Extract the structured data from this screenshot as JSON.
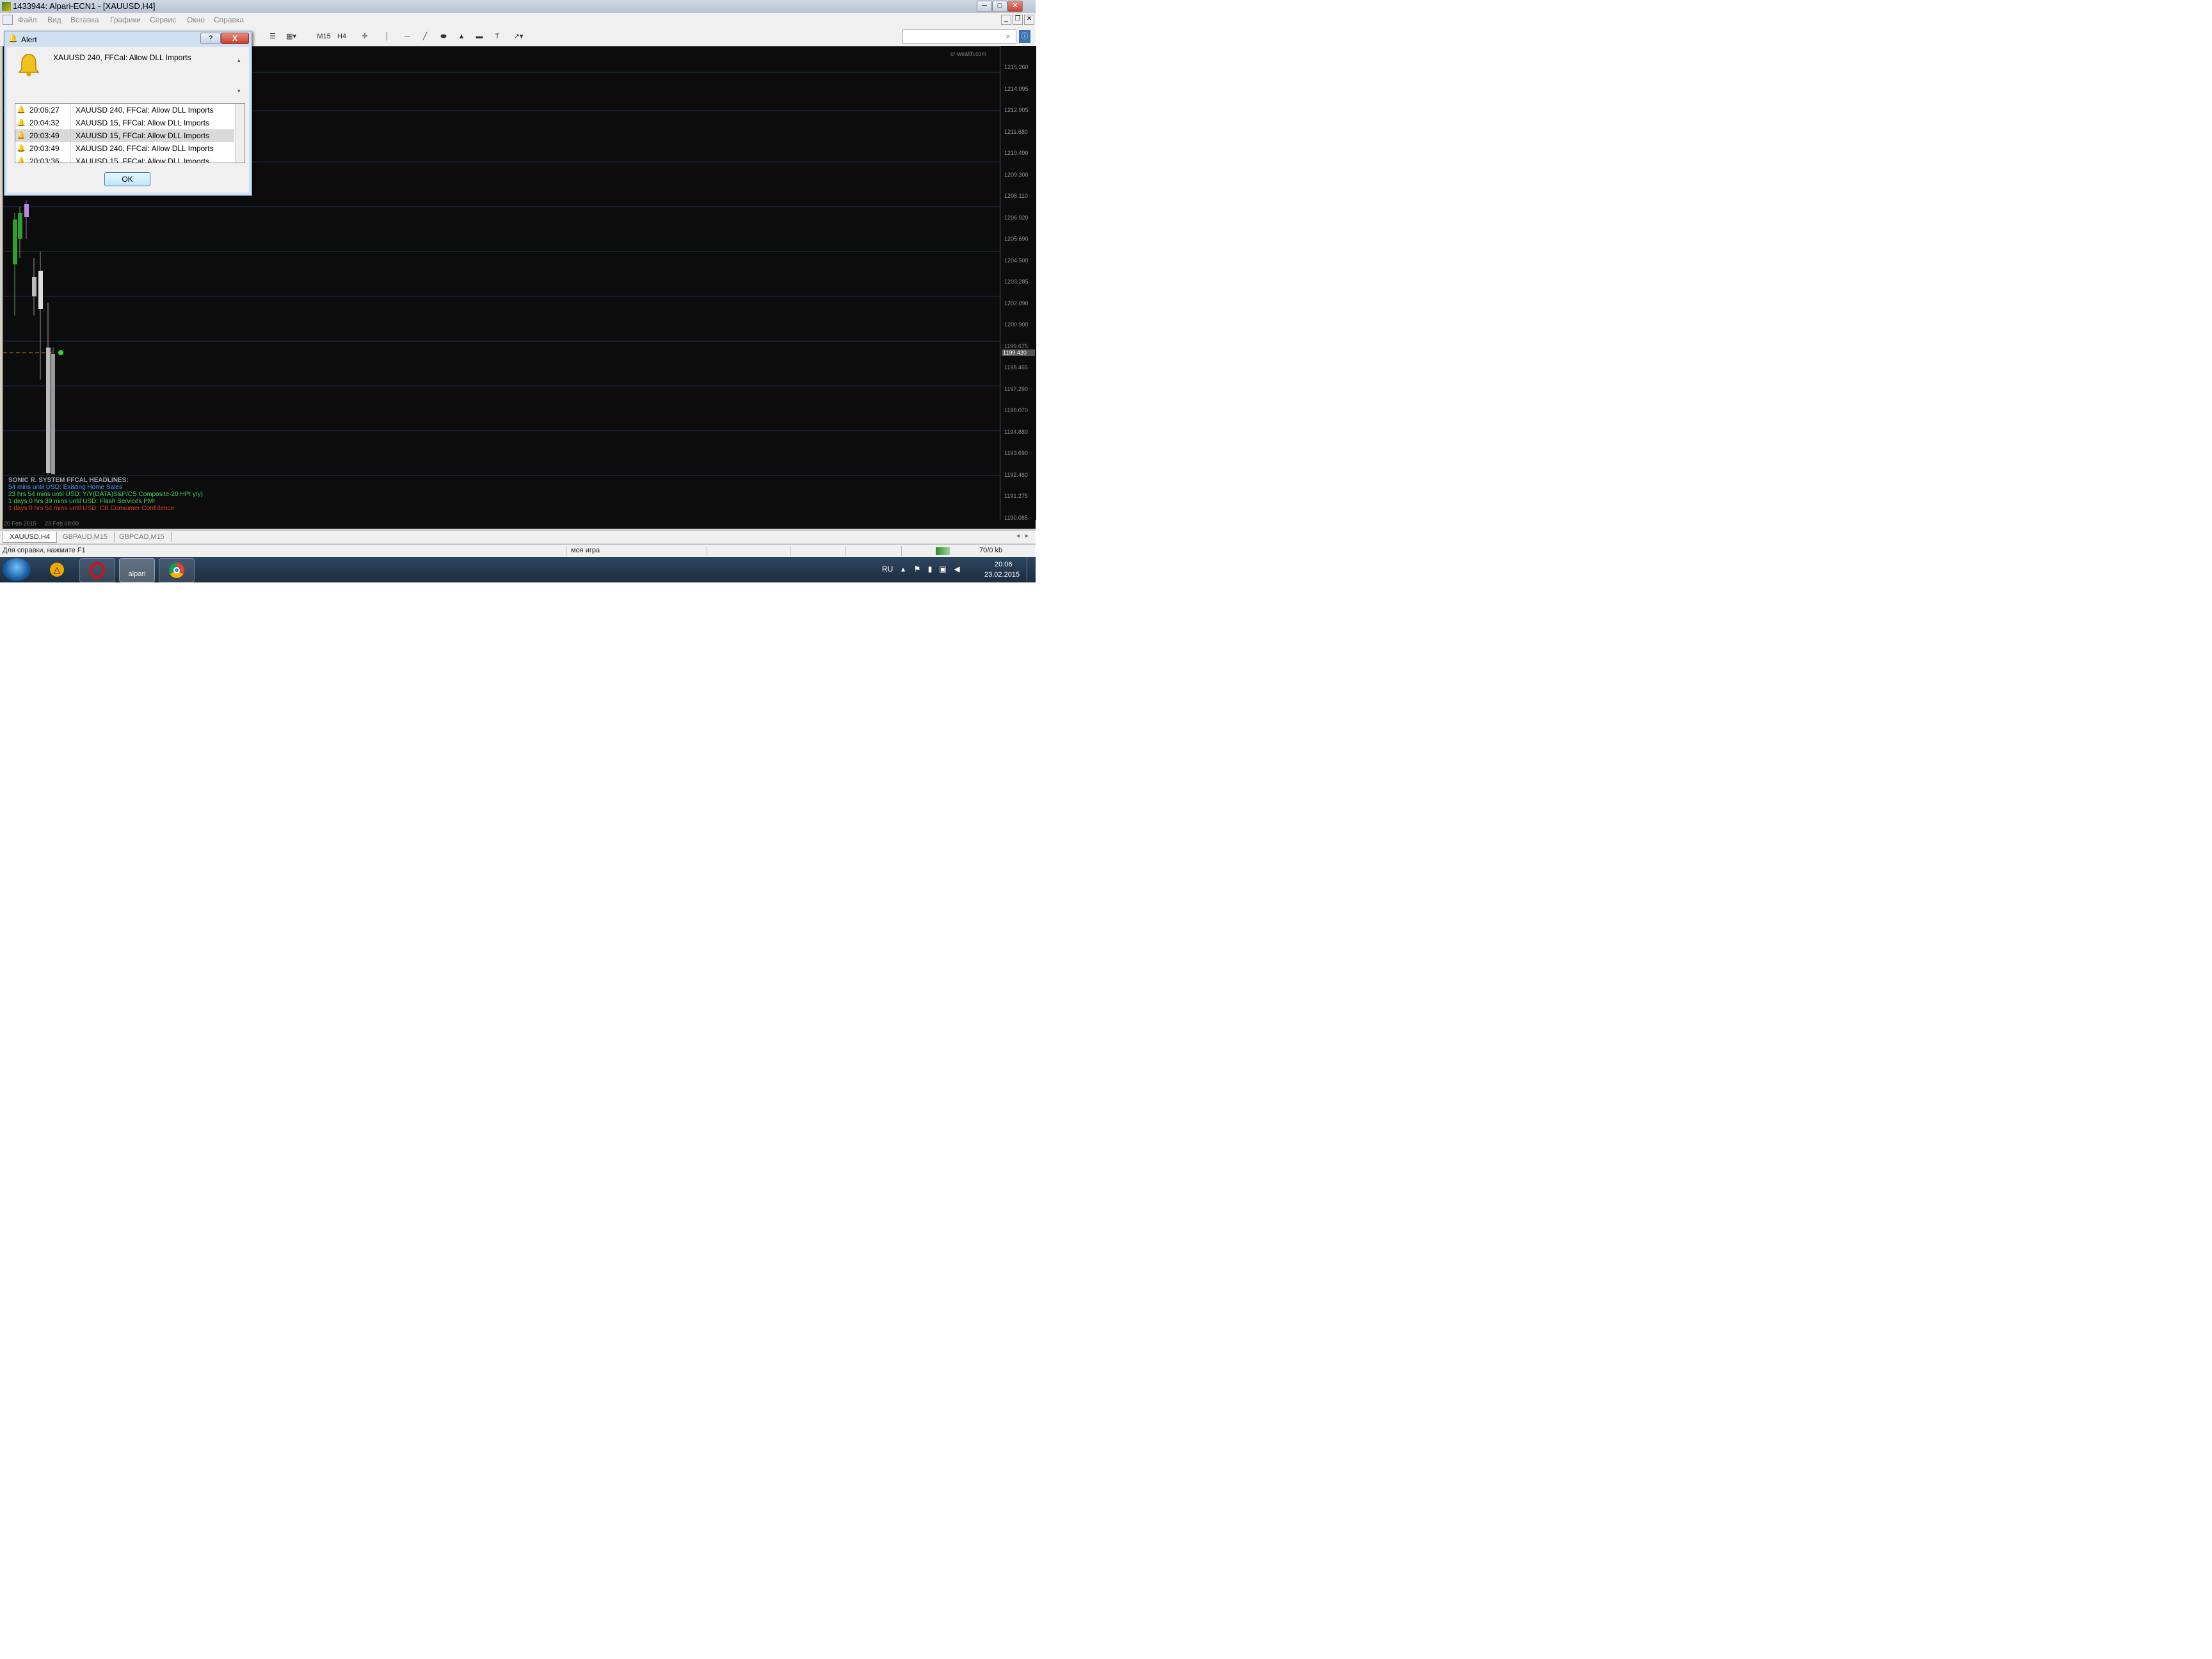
{
  "window": {
    "title": "1433944: Alpari-ECN1 - [XAUUSD,H4]",
    "minimize": "─",
    "maximize": "□",
    "close": "✕"
  },
  "menu": [
    "Файл",
    "Вид",
    "Вставка",
    "Графики",
    "Сервис",
    "Окно",
    "Справка"
  ],
  "toolbar": {
    "m15": "M15",
    "h4": "H4"
  },
  "chart": {
    "corner_label": "cr-wealth.com",
    "price_labels": [
      "1215.260",
      "1214.095",
      "1212.905",
      "1211.680",
      "1210.490",
      "1209.300",
      "1208.110",
      "1206.920",
      "1205.690",
      "1204.500",
      "1203.285",
      "1202.090",
      "1200.900",
      "1199.675",
      "1198.465",
      "1197.290",
      "1196.070",
      "1194.880",
      "1193.690",
      "1192.460",
      "1191.275",
      "1190.085"
    ],
    "current_price": "1199.420",
    "news_title": "SONIC R. SYSTEM  FFCAL HEADLINES:",
    "news_lines": [
      {
        "text": "54 mins until USD: Existing Home Sales",
        "color": "#3fa0ff"
      },
      {
        "text": "23 hrs 54 mins until USD: Y/Y(DATA)S&P/CS Composite-20 HPI y/y)",
        "color": "#3fd05f"
      },
      {
        "text": "1 days 0 hrs 39 mins until USD: Flash Services PMI",
        "color": "#3fd05f"
      },
      {
        "text": "1 days 0 hrs 54 mins until USD: CB Consumer Confidence",
        "color": "#e0392d"
      }
    ],
    "time_labels": [
      "20 Feb 2015",
      "23 Feb 08:00"
    ]
  },
  "tabs": [
    "XAUUSD,H4",
    "GBPAUD,M15",
    "GBPCAD,M15"
  ],
  "status": {
    "help": "Для справки, нажмите F1",
    "profile": "моя игра",
    "traffic": "70/0 kb"
  },
  "taskbar": {
    "alpari_label": "alpari",
    "lang": "RU",
    "time": "20:06",
    "date": "23.02.2015"
  },
  "dialog": {
    "title": "Alert",
    "help": "?",
    "close": "X",
    "message": "XAUUSD 240, FFCal: Allow DLL Imports",
    "ok": "OK",
    "rows": [
      {
        "time": "20:06:27",
        "msg": "XAUUSD 240, FFCal: Allow DLL Imports"
      },
      {
        "time": "20:04:32",
        "msg": "XAUUSD 15, FFCal: Allow DLL Imports"
      },
      {
        "time": "20:03:49",
        "msg": "XAUUSD 15, FFCal: Allow DLL Imports"
      },
      {
        "time": "20:03:49",
        "msg": "XAUUSD 240, FFCal: Allow DLL Imports"
      },
      {
        "time": "20:03:36",
        "msg": "XAUUSD 15, FFCal: Allow DLL Imports"
      }
    ]
  }
}
